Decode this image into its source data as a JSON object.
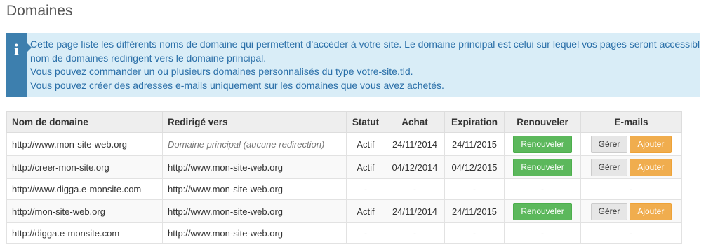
{
  "page": {
    "title": "Domaines"
  },
  "info": {
    "lines": [
      "Cette page liste les différents noms de domaine qui permettent d'accéder à votre site. Le domaine principal est celui sur lequel vos pages seront accessibles, les autres",
      "nom de domaines redirigent vers le domaine principal.",
      "Vous pouvez commander un ou plusieurs domaines personnalisés du type votre-site.tld.",
      "Vous pouvez créer des adresses e-mails uniquement sur les domaines que vous avez achetés."
    ]
  },
  "table": {
    "headers": {
      "domain": "Nom de domaine",
      "redirect": "Redirigé vers",
      "status": "Statut",
      "purchase": "Achat",
      "expiration": "Expiration",
      "renew": "Renouveler",
      "emails": "E-mails"
    },
    "rows": [
      {
        "domain": "http://www.mon-site-web.org",
        "redirect": "Domaine principal (aucune redirection)",
        "status": "Actif",
        "purchase": "24/11/2014",
        "expiration": "24/11/2015",
        "renew_label": "Renouveler",
        "manage_label": "Gérer",
        "add_label": "Ajouter"
      },
      {
        "domain": "http://creer-mon-site.org",
        "redirect": "http://www.mon-site-web.org",
        "status": "Actif",
        "purchase": "04/12/2014",
        "expiration": "04/12/2015",
        "renew_label": "Renouveler",
        "manage_label": "Gérer",
        "add_label": "Ajouter"
      },
      {
        "domain": "http://www.digga.e-monsite.com",
        "redirect": "http://www.mon-site-web.org",
        "status": "-",
        "purchase": "-",
        "expiration": "-",
        "renew": "-",
        "emails": "-"
      },
      {
        "domain": "http://mon-site-web.org",
        "redirect": "http://www.mon-site-web.org",
        "status": "Actif",
        "purchase": "24/11/2014",
        "expiration": "24/11/2015",
        "renew_label": "Renouveler",
        "manage_label": "Gérer",
        "add_label": "Ajouter"
      },
      {
        "domain": "http://digga.e-monsite.com",
        "redirect": "http://www.mon-site-web.org",
        "status": "-",
        "purchase": "-",
        "expiration": "-",
        "renew": "-",
        "emails": "-"
      }
    ]
  },
  "colors": {
    "info_background": "#d9edf7",
    "info_accent": "#3d7fae",
    "info_text": "#2a6fa8",
    "renew_button": "#5cb85c",
    "add_button": "#f0ad4e",
    "manage_button": "#e6e6e6"
  },
  "icons": {
    "info": "info-icon"
  }
}
